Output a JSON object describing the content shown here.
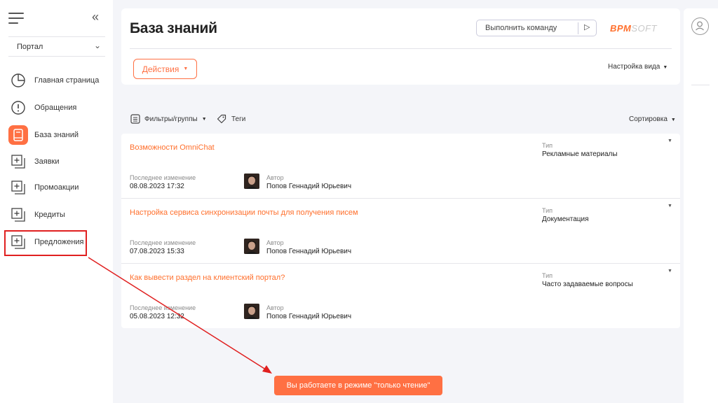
{
  "sidebar": {
    "portal_label": "Портал",
    "items": [
      {
        "label": "Главная страница",
        "icon": "pie-chart-icon"
      },
      {
        "label": "Обращения",
        "icon": "alert-circle-icon"
      },
      {
        "label": "База знаний",
        "icon": "book-icon",
        "active": true
      },
      {
        "label": "Заявки",
        "icon": "add-copy-icon"
      },
      {
        "label": "Промоакции",
        "icon": "add-copy-icon"
      },
      {
        "label": "Кредиты",
        "icon": "add-copy-icon"
      },
      {
        "label": "Предложения",
        "icon": "add-copy-icon"
      }
    ]
  },
  "header": {
    "title": "База знаний",
    "command_placeholder": "Выполнить команду",
    "logo_bold": "BPM",
    "logo_light": "SOFT",
    "actions_label": "Действия",
    "view_settings_label": "Настройка вида"
  },
  "toolbar": {
    "filters_label": "Фильтры/группы",
    "tags_label": "Теги",
    "sort_label": "Сортировка"
  },
  "list": {
    "type_label": "Тип",
    "modified_label": "Последнее изменение",
    "author_label": "Автор",
    "rows": [
      {
        "title": "Возможности OmniChat",
        "type": "Рекламные материалы",
        "modified": "08.08.2023 17:32",
        "author": "Попов Геннадий Юрьевич"
      },
      {
        "title": "Настройка сервиса синхронизации почты для получения писем",
        "type": "Документация",
        "modified": "07.08.2023 15:33",
        "author": "Попов Геннадий Юрьевич"
      },
      {
        "title": "Как вывести раздел на клиентский портал?",
        "type": "Часто задаваемые вопросы",
        "modified": "05.08.2023 12:32",
        "author": "Попов Геннадий Юрьевич"
      }
    ]
  },
  "toast": {
    "message": "Вы работаете в режиме \"только чтение\""
  },
  "colors": {
    "accent": "#ff7043",
    "highlight": "#e02020"
  }
}
